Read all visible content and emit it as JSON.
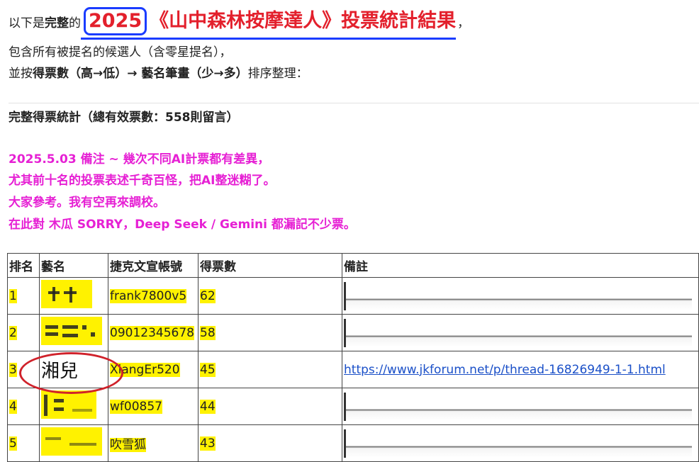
{
  "intro": {
    "pre": "以下是",
    "pre_bold": "完整",
    "pre_after": "的",
    "year": "2025",
    "title": "《山中森林按摩達人》投票統計結果",
    "comma": "，",
    "line2": "包含所有被提名的候選人（含零星提名），",
    "line3_pre": "並按",
    "line3_bold": "得票數（高→低）→ 藝名筆畫（少→多）",
    "line3_post": "排序整理："
  },
  "stats": {
    "heading": "完整得票統計（總有效票數：558則留言）"
  },
  "notes": [
    "2025.5.03 備注 ~ 幾次不同AI計票都有差異，",
    "尤其前十名的投票表述千奇百怪，把AI整迷糊了。",
    "大家參考。我有空再來調校。",
    "在此對 木瓜 SORRY，Deep Seek / Gemini 都漏記不少票。"
  ],
  "table": {
    "headers": [
      "排名",
      "藝名",
      "捷克文宣帳號",
      "得票數",
      "備註"
    ],
    "rows": [
      {
        "rank": "1",
        "name": "",
        "account": "frank7800v5",
        "votes": "62",
        "note": ""
      },
      {
        "rank": "2",
        "name": "",
        "account": "09012345678",
        "votes": "58",
        "note": ""
      },
      {
        "rank": "3",
        "name": "湘兒",
        "account": "XiangEr520",
        "votes": "45",
        "note": "https://www.jkforum.net/p/thread-16826949-1-1.html"
      },
      {
        "rank": "4",
        "name": "",
        "account": "wf00857",
        "votes": "44",
        "note": ""
      },
      {
        "rank": "5",
        "name": "",
        "account": "吹雪狐",
        "votes": "43",
        "note": ""
      }
    ]
  },
  "colors": {
    "title_red": "#e3202c",
    "box_blue": "#1a3cff",
    "note_magenta": "#e620d4",
    "highlight": "#fff200",
    "link": "#1b50c8"
  }
}
